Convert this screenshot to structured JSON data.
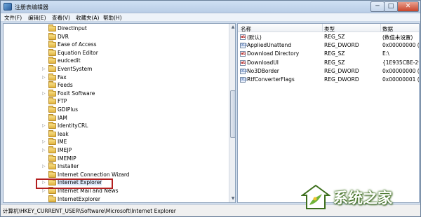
{
  "window": {
    "title": "注册表编辑器",
    "minimize": "─",
    "maximize": "□",
    "close": "✕"
  },
  "menubar": [
    {
      "label": "文件(F)"
    },
    {
      "label": "编辑(E)"
    },
    {
      "label": "查看(V)"
    },
    {
      "label": "收藏夹(A)"
    },
    {
      "label": "帮助(H)"
    }
  ],
  "tree": {
    "items": [
      {
        "label": "DirectInput",
        "expander": ""
      },
      {
        "label": "DVR",
        "expander": ""
      },
      {
        "label": "Ease of Access",
        "expander": ""
      },
      {
        "label": "Equation Editor",
        "expander": ""
      },
      {
        "label": "eudcedit",
        "expander": ""
      },
      {
        "label": "EventSystem",
        "expander": "▷"
      },
      {
        "label": "Fax",
        "expander": "▷"
      },
      {
        "label": "Feeds",
        "expander": ""
      },
      {
        "label": "Foxit Software",
        "expander": "▷"
      },
      {
        "label": "FTP",
        "expander": ""
      },
      {
        "label": "GDIPlus",
        "expander": ""
      },
      {
        "label": "IAM",
        "expander": ""
      },
      {
        "label": "IdentityCRL",
        "expander": "▷"
      },
      {
        "label": "Ieak",
        "expander": ""
      },
      {
        "label": "IME",
        "expander": "▷"
      },
      {
        "label": "IMEJP",
        "expander": "▷"
      },
      {
        "label": "IMEMIP",
        "expander": ""
      },
      {
        "label": "Installer",
        "expander": "▷"
      },
      {
        "label": "Internet Connection Wizard",
        "expander": ""
      },
      {
        "label": "Internet Explorer",
        "expander": "▷"
      },
      {
        "label": "Internet Mail and News",
        "expander": "▷"
      },
      {
        "label": "InternetExplorer",
        "expander": ""
      }
    ],
    "scroll_up": "▲",
    "scroll_down": "▼"
  },
  "values": {
    "headers": {
      "name": "名称",
      "type": "类型",
      "data": "数据"
    },
    "rows": [
      {
        "name": "(默认)",
        "type": "REG_SZ",
        "data": "(数值未设置)",
        "icon": "ab"
      },
      {
        "name": "AppliedUnattend",
        "type": "REG_DWORD",
        "data": "0x00000000 (0",
        "icon": "011"
      },
      {
        "name": "Download Directory",
        "type": "REG_SZ",
        "data": "E:\\",
        "icon": "ab"
      },
      {
        "name": "DownloadUI",
        "type": "REG_SZ",
        "data": "{1E935CBE-29",
        "icon": "ab"
      },
      {
        "name": "No3DBorder",
        "type": "REG_DWORD",
        "data": "0x00000000 (0",
        "icon": "011"
      },
      {
        "name": "RtfConverterFlags",
        "type": "REG_DWORD",
        "data": "0x00000001 (1",
        "icon": "011"
      }
    ]
  },
  "statusbar": {
    "path": "计算机\\HKEY_CURRENT_USER\\Software\\Microsoft\\Internet Explorer"
  },
  "watermark": {
    "text": "系统之家"
  },
  "colors": {
    "highlight": "#b31f1f",
    "folder": "#e1b33f",
    "watermark_green": "#3d6f1d"
  }
}
